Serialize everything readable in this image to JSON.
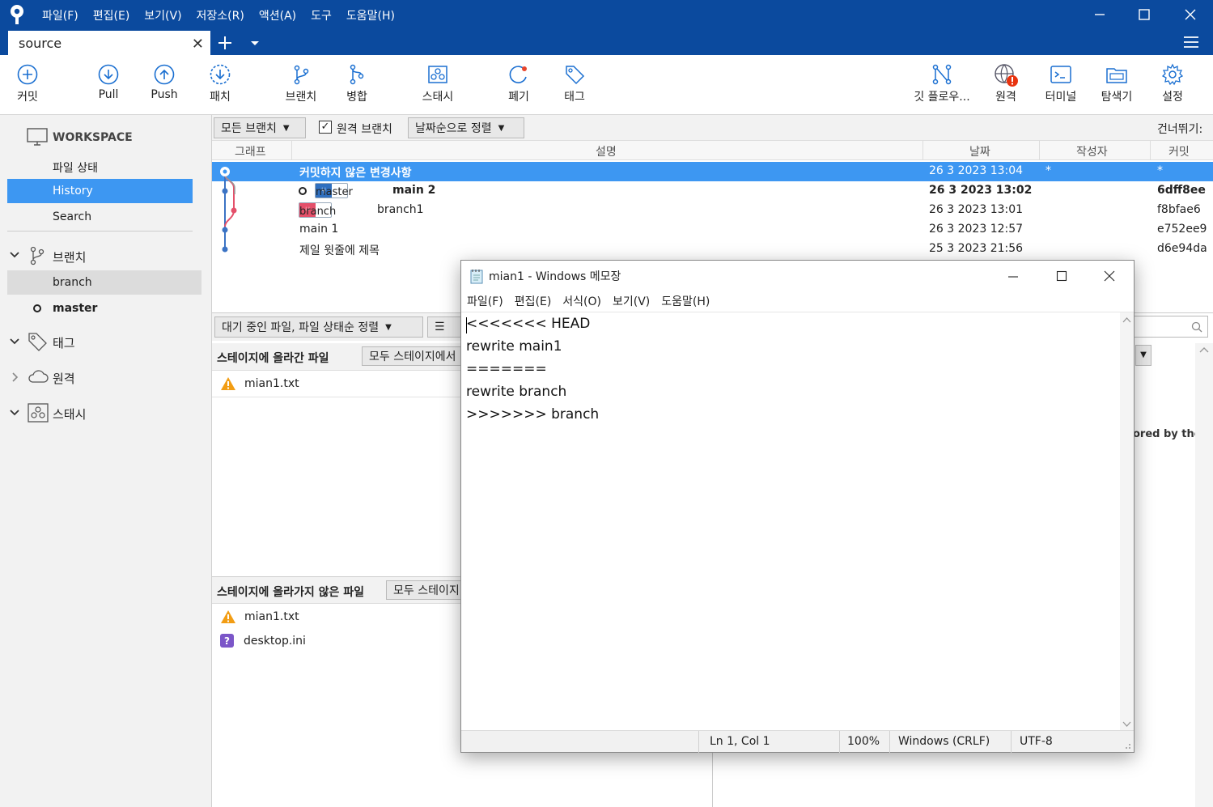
{
  "app": {
    "menu": [
      "파일(F)",
      "편집(E)",
      "보기(V)",
      "저장소(R)",
      "액션(A)",
      "도구",
      "도움말(H)"
    ],
    "tab_title": "source"
  },
  "toolbar": {
    "commit": "커밋",
    "pull": "Pull",
    "push": "Push",
    "patch": "패치",
    "branch": "브랜치",
    "merge": "병합",
    "stash": "스태시",
    "discard": "폐기",
    "tag": "태그",
    "gitflow": "깃 플로우...",
    "remote": "원격",
    "terminal": "터미널",
    "explorer": "탐색기",
    "settings": "설정"
  },
  "sidebar": {
    "workspace": "WORKSPACE",
    "file_status": "파일 상태",
    "history": "History",
    "search": "Search",
    "branches": "브랜치",
    "branch_items": [
      "branch",
      "master"
    ],
    "tags": "태그",
    "remotes": "원격",
    "stashes": "스태시"
  },
  "filter": {
    "all_branches": "모든 브랜치",
    "remote_branches": "원격 브랜치",
    "sort": "날짜순으로 정렬",
    "jump": "건너뛰기:"
  },
  "history": {
    "columns": {
      "graph": "그래프",
      "desc": "설명",
      "date": "날짜",
      "author": "작성자",
      "commit": "커밋"
    },
    "rows": [
      {
        "desc": "커밋하지 않은 변경사항",
        "date": "26 3 2023 13:04",
        "author": "*",
        "commit": "*"
      },
      {
        "label": "master",
        "desc": "main 2",
        "date": "26 3 2023 13:02",
        "author": "",
        "commit": "6dff8ee"
      },
      {
        "label": "branch",
        "desc": "branch1",
        "date": "26 3 2023 13:01",
        "author": "",
        "commit": "f8bfae6"
      },
      {
        "desc": "main 1",
        "date": "26 3 2023 12:57",
        "author": "",
        "commit": "e752ee9"
      },
      {
        "desc": "제일 윗줄에 제목",
        "date": "25 3 2023 21:56",
        "author": "",
        "commit": "d6e94da"
      }
    ]
  },
  "files": {
    "sort": "대기 중인 파일, 파일 상태순 정렬",
    "staged_title": "스테이지에 올라간 파일",
    "unstage_all": "모두 스테이지에서",
    "staged": [
      "mian1.txt"
    ],
    "unstaged_title": "스테이지에 올라가지 않은 파일",
    "stage_all": "모두 스테이지",
    "unstaged": [
      "mian1.txt",
      "desktop.ini"
    ],
    "diff_partial": "ored by the"
  },
  "notepad": {
    "title": "mian1 - Windows 메모장",
    "menu": [
      "파일(F)",
      "편집(E)",
      "서식(O)",
      "보기(V)",
      "도움말(H)"
    ],
    "content": "<<<<<<< HEAD\nrewrite main1\n=======\nrewrite branch\n>>>>>>> branch",
    "status": {
      "position": "Ln 1, Col 1",
      "zoom": "100%",
      "eol": "Windows (CRLF)",
      "encoding": "UTF-8"
    }
  }
}
